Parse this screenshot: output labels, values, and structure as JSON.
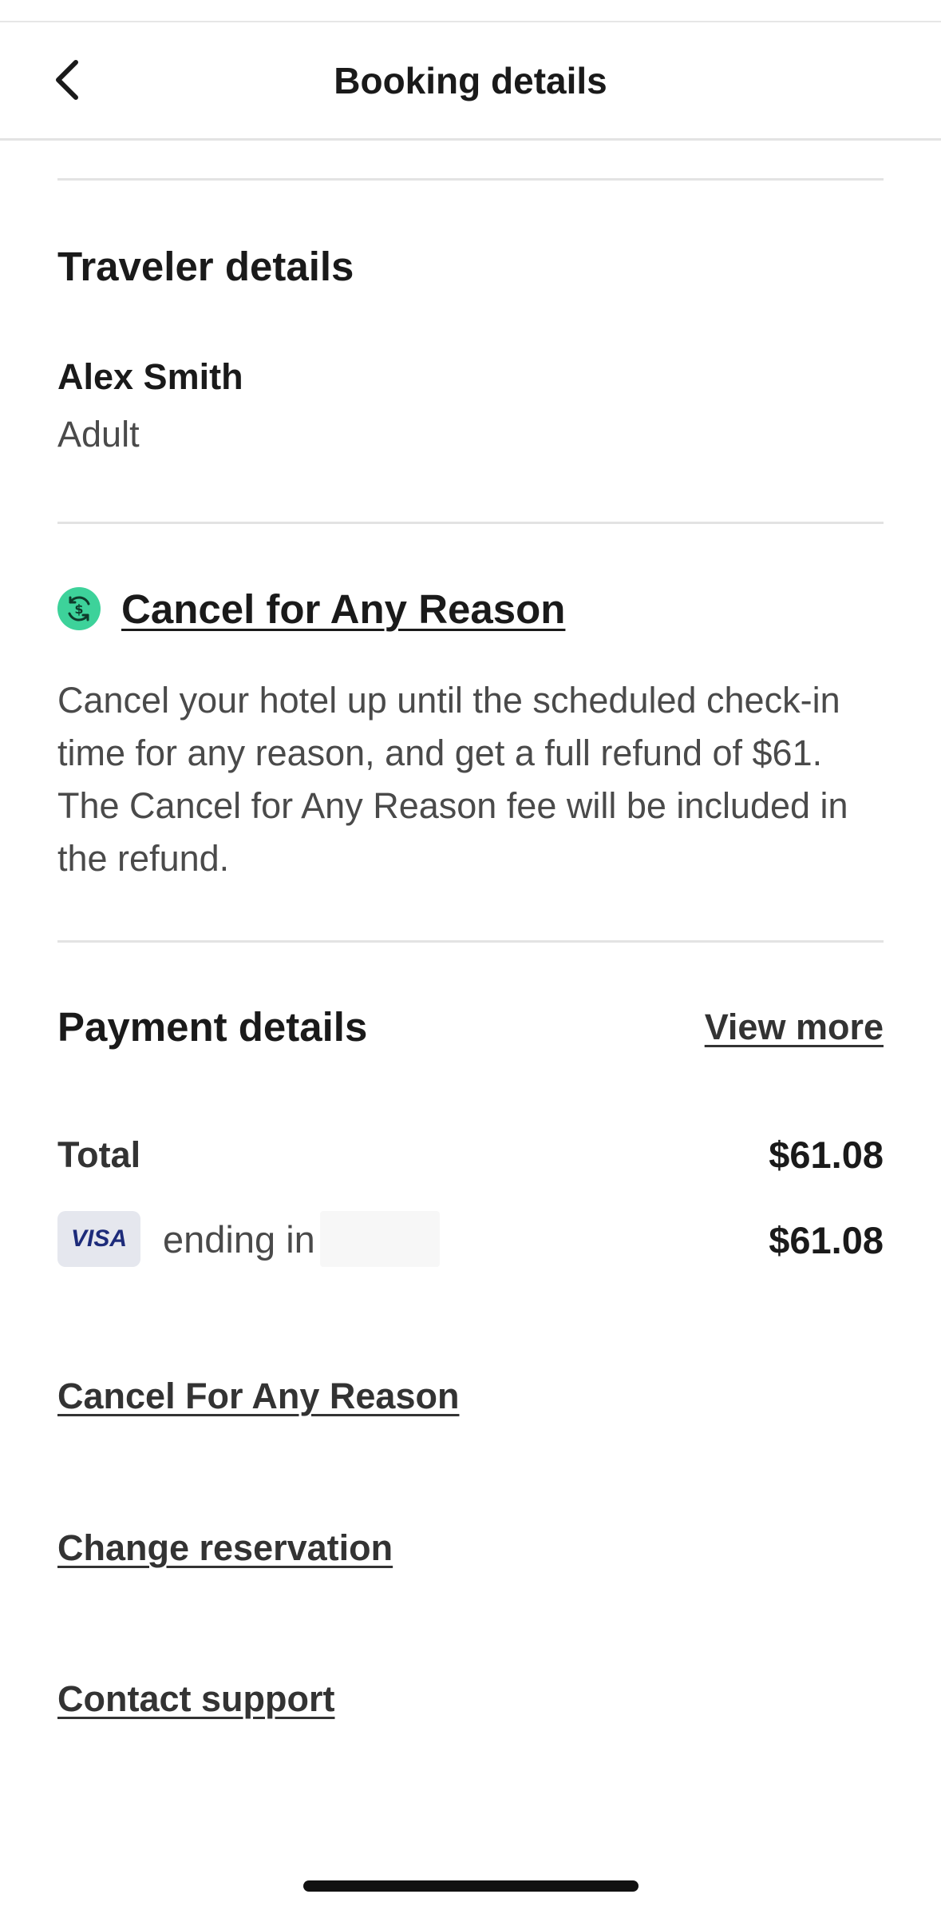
{
  "header": {
    "title": "Booking details",
    "back_icon": "chevron-left-icon"
  },
  "traveler": {
    "section_title": "Traveler details",
    "name": "Alex Smith",
    "type": "Adult"
  },
  "cancel_for_any_reason": {
    "icon": "refund-dollar-icon",
    "icon_color": "#3dd29a",
    "title": "Cancel for Any Reason",
    "description": "Cancel your hotel up until the scheduled check-in time for any reason, and get a full refund of $61. The Cancel for Any Reason fee will be included in the refund."
  },
  "payment": {
    "section_title": "Payment details",
    "view_more": "View more",
    "total_label": "Total",
    "total_amount": "$61.08",
    "card_brand": "VISA",
    "card_ending_label": "ending in",
    "card_amount": "$61.08"
  },
  "actions": {
    "cancel_for_any_reason": "Cancel For Any Reason",
    "change_reservation": "Change reservation",
    "contact_support": "Contact support"
  }
}
